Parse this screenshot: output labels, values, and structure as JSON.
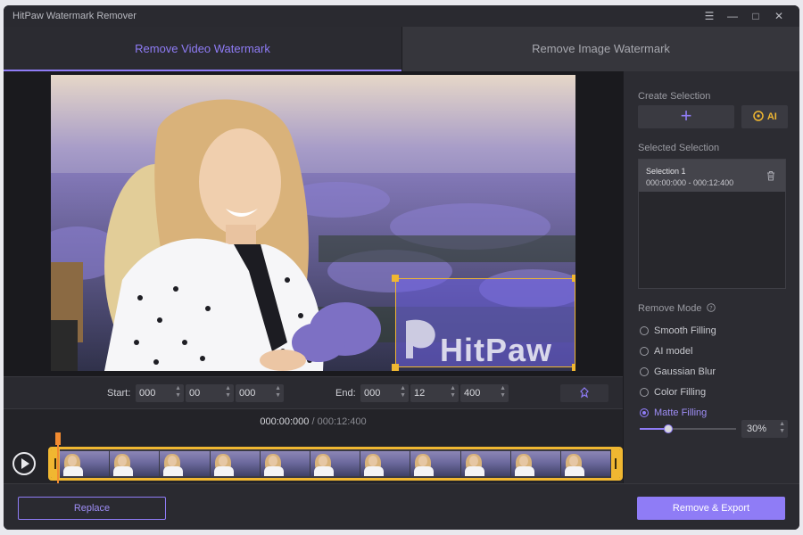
{
  "window": {
    "title": "HitPaw Watermark Remover",
    "controls": {
      "menu": "☰",
      "minimize": "—",
      "maximize": "□",
      "close": "✕"
    }
  },
  "tabs": [
    {
      "label": "Remove Video Watermark",
      "active": true
    },
    {
      "label": "Remove Image Watermark",
      "active": false
    }
  ],
  "preview": {
    "watermark_text": "HitPaw"
  },
  "range": {
    "start_label": "Start:",
    "start": [
      "000",
      "00",
      "000"
    ],
    "end_label": "End:",
    "end": [
      "000",
      "12",
      "400"
    ]
  },
  "timeline": {
    "current": "000:00:000",
    "separator": "/",
    "total": "000:12:400",
    "frame_count": 11
  },
  "sidebar": {
    "create_selection_label": "Create Selection",
    "add_icon": "+",
    "ai_label": "AI",
    "selected_selection_label": "Selected Selection",
    "selections": [
      {
        "name": "Selection 1",
        "range": "000:00:000 - 000:12:400"
      }
    ],
    "remove_mode_label": "Remove Mode",
    "modes": [
      {
        "label": "Smooth Filling",
        "selected": false
      },
      {
        "label": "AI model",
        "selected": false
      },
      {
        "label": "Gaussian Blur",
        "selected": false
      },
      {
        "label": "Color Filling",
        "selected": false
      },
      {
        "label": "Matte Filling",
        "selected": true
      }
    ],
    "matte_percent": "30%",
    "matte_level": 0.3
  },
  "footer": {
    "replace_label": "Replace",
    "export_label": "Remove & Export"
  },
  "colors": {
    "accent": "#8f7cf6",
    "selection_frame": "#f0b731",
    "playhead": "#f28b30"
  }
}
